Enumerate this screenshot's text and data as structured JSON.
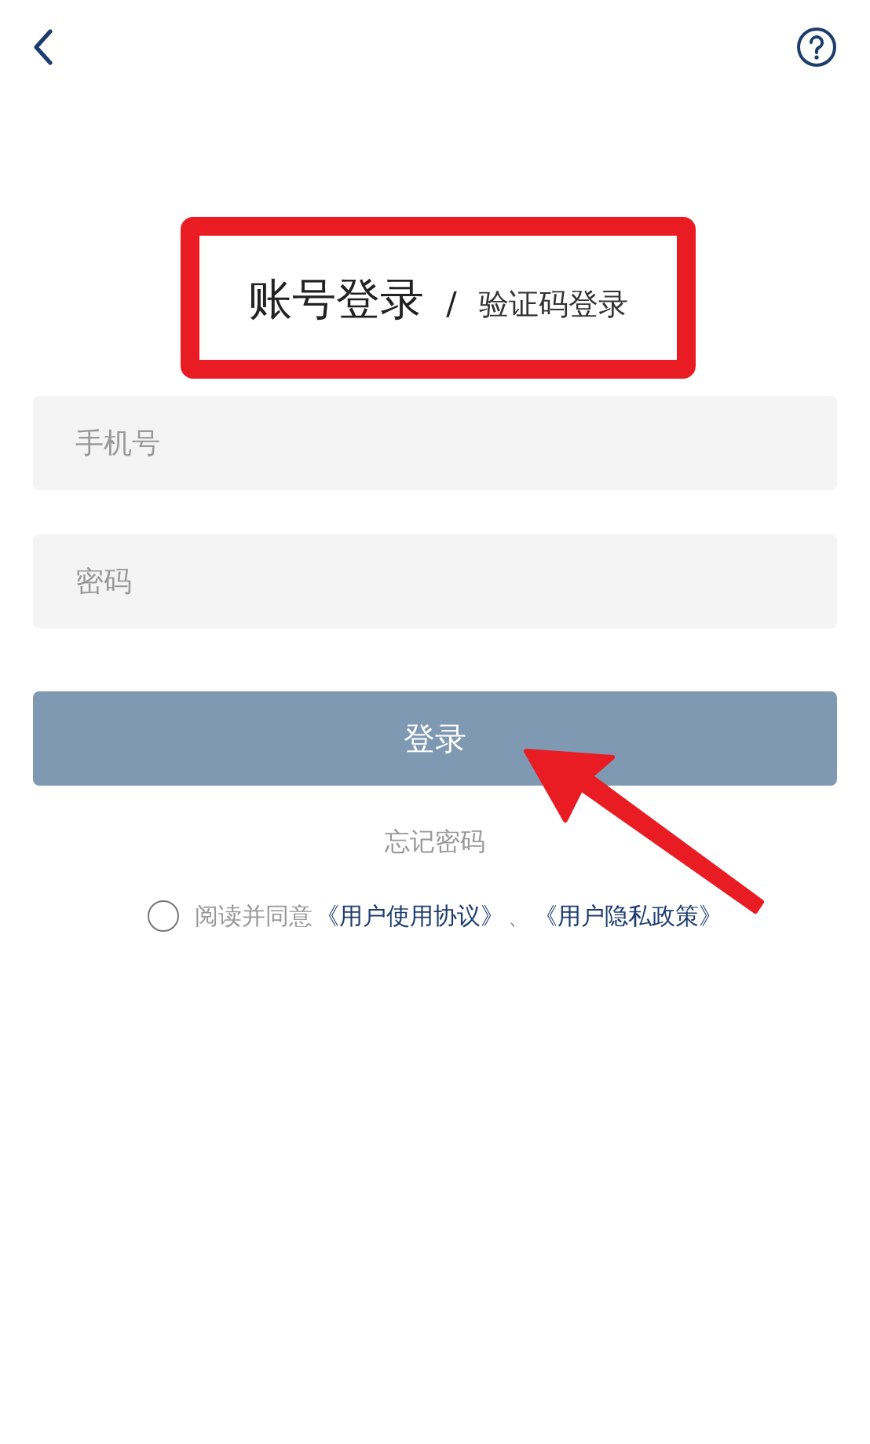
{
  "tabs": [
    {
      "label": "账号登录",
      "selected": true
    },
    {
      "label": "验证码登录",
      "selected": false
    }
  ],
  "tab_separator": "/",
  "fields": [
    {
      "placeholder": "手机号"
    },
    {
      "placeholder": "密码"
    }
  ],
  "login_button": "登录",
  "forgot_link": "忘记密码",
  "agreement": {
    "checked": false,
    "text": "阅读并同意",
    "links": [
      "《用户使用协议》",
      "《用户隐私政策》"
    ],
    "separator": "、"
  }
}
